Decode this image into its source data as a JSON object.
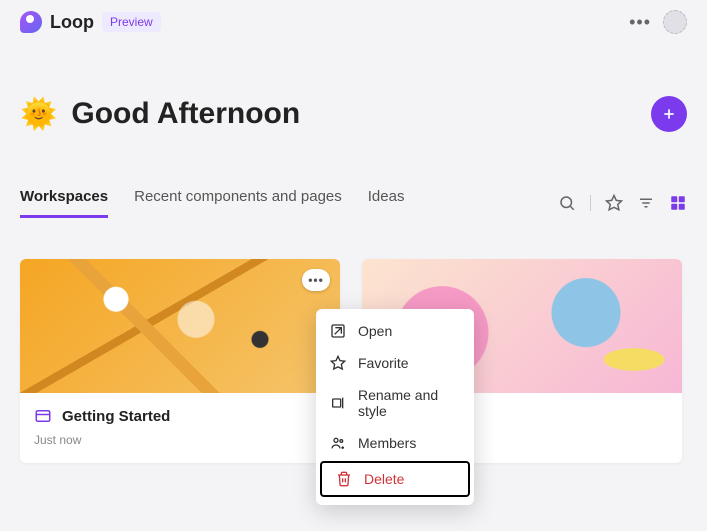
{
  "header": {
    "brand": "Loop",
    "badge": "Preview"
  },
  "greeting": {
    "emoji": "🌞",
    "text": "Good Afternoon"
  },
  "tabs": {
    "items": [
      {
        "label": "Workspaces",
        "active": true
      },
      {
        "label": "Recent components and pages",
        "active": false
      },
      {
        "label": "Ideas",
        "active": false
      }
    ]
  },
  "cards": [
    {
      "title": "Getting Started",
      "time": "Just now"
    }
  ],
  "context_menu": {
    "items": [
      {
        "label": "Open",
        "icon": "open-icon"
      },
      {
        "label": "Favorite",
        "icon": "star-icon"
      },
      {
        "label": "Rename and style",
        "icon": "rename-icon"
      },
      {
        "label": "Members",
        "icon": "members-icon"
      },
      {
        "label": "Delete",
        "icon": "trash-icon",
        "danger": true
      }
    ]
  }
}
